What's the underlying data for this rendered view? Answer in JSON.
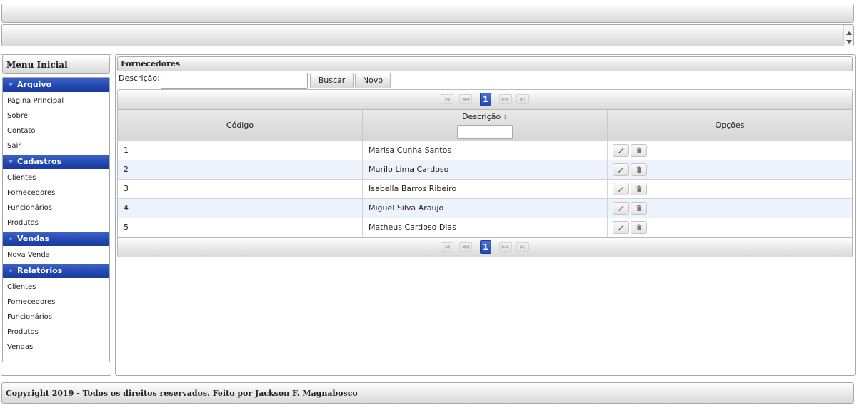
{
  "menu": {
    "title": "Menu Inicial",
    "sections": [
      {
        "label": "Arquivo",
        "items": [
          "Página Principal",
          "Sobre",
          "Contato",
          "Sair"
        ]
      },
      {
        "label": "Cadastros",
        "items": [
          "Clientes",
          "Fornecedores",
          "Funcionários",
          "Produtos"
        ]
      },
      {
        "label": "Vendas",
        "items": [
          "Nova Venda"
        ]
      },
      {
        "label": "Relatórios",
        "items": [
          "Clientes",
          "Fornecedores",
          "Funcionários",
          "Produtos",
          "Vendas"
        ]
      }
    ]
  },
  "panel": {
    "title": "Fornecedores",
    "search_label": "Descrição:",
    "search_value": "",
    "buscar_label": "Buscar",
    "novo_label": "Novo"
  },
  "paginator": {
    "current_page": "1",
    "first_icon": "first-page-icon",
    "prev_icon": "prev-page-icon",
    "next_icon": "next-page-icon",
    "last_icon": "last-page-icon"
  },
  "table": {
    "columns": {
      "codigo": "Código",
      "descricao": "Descrição",
      "opcoes": "Opções"
    },
    "sort_icon": "sort-icon",
    "filter_value": "",
    "rows": [
      {
        "codigo": "1",
        "descricao": "Marisa Cunha Santos"
      },
      {
        "codigo": "2",
        "descricao": "Murilo Lima Cardoso"
      },
      {
        "codigo": "3",
        "descricao": "Isabella Barros Ribeiro"
      },
      {
        "codigo": "4",
        "descricao": "Miguel Silva Araujo"
      },
      {
        "codigo": "5",
        "descricao": "Matheus Cardoso Dias"
      }
    ],
    "row_actions": [
      "edit-icon",
      "trash-icon"
    ]
  },
  "footer": {
    "text": "Copyright 2019 - Todos os direitos reservados. Feito por Jackson F. Magnabosco"
  },
  "colors": {
    "accent": "#2146ad",
    "row_alt": "#edf3fd",
    "border": "#a8a8a8"
  }
}
